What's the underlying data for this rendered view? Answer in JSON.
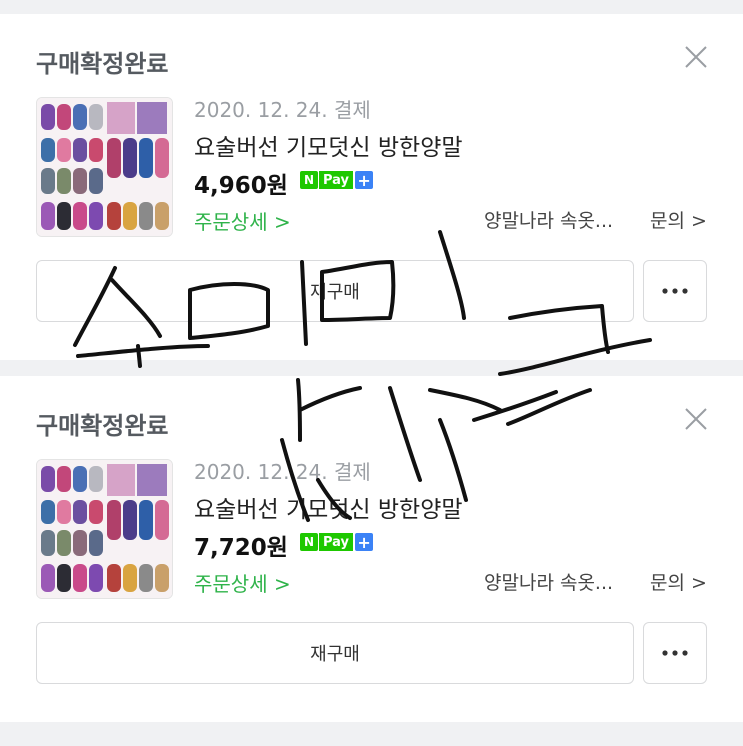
{
  "orders": [
    {
      "status": "구매확정완료",
      "date": "2020. 12. 24. 결제",
      "product_name": "요술버선 기모덧신 방한양말",
      "price": "4,960원",
      "npay_n": "N",
      "npay_pay": "Pay",
      "npay_plus": "+",
      "order_detail": "주문상세 >",
      "seller": "양말나라 속옷...",
      "inquiry": "문의 >",
      "rebuy": "재구매"
    },
    {
      "status": "구매확정완료",
      "date": "2020. 12. 24. 결제",
      "product_name": "요술버선 기모덧신 방한양말",
      "price": "7,720원",
      "npay_n": "N",
      "npay_pay": "Pay",
      "npay_plus": "+",
      "order_detail": "주문상세 >",
      "seller": "양말나라 속옷...",
      "inquiry": "문의 >",
      "rebuy": "재구매"
    }
  ],
  "icons": {
    "close": "close-icon",
    "more": "more-icon",
    "thumbnail": "product-thumbnail"
  },
  "colors": {
    "accent_green": "#2fb34a",
    "npay_green": "#1ec800",
    "npay_plus_blue": "#3b82f6",
    "page_bg": "#f0f1f3"
  }
}
